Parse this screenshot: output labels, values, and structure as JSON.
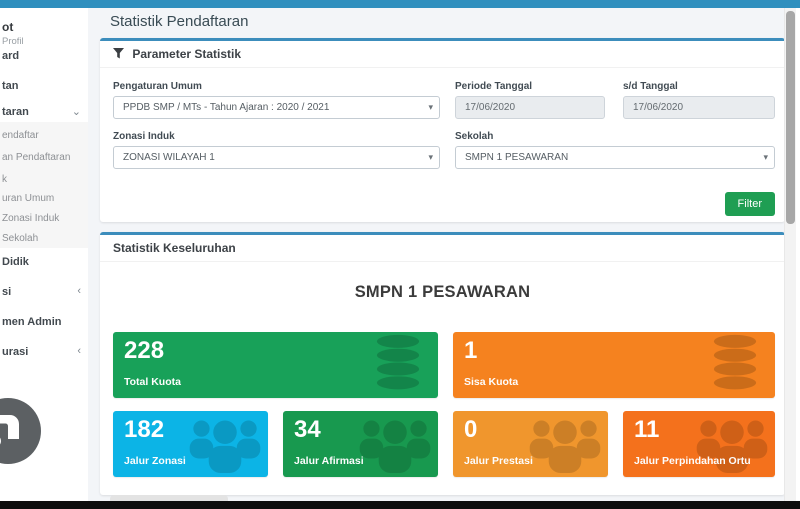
{
  "chrome": {
    "top_bar_color": "#2f8fbe",
    "bottom_bar_color": "#0d0d0d",
    "card_accent_color": "#3c8dbc"
  },
  "icons": {
    "chevron_down": "⌄",
    "chevron_left": "‹",
    "dropdown_caret": "▾"
  },
  "sidebar": {
    "user_name_fragment": "ot",
    "user_link_fragment": "Profil",
    "items": [
      {
        "label": "ard"
      },
      {
        "label": "tan"
      },
      {
        "label": "taran"
      },
      {
        "label": "endaftar"
      },
      {
        "label": "an Pendaftaran"
      },
      {
        "label": "k"
      },
      {
        "label": "uran Umum"
      },
      {
        "label": "Zonasi Induk"
      },
      {
        "label": "Sekolah"
      },
      {
        "label": "Didik"
      },
      {
        "label": "si"
      },
      {
        "label": "men Admin"
      },
      {
        "label": "urasi"
      }
    ]
  },
  "page_title": "Statistik Pendaftaran",
  "filter_card": {
    "header": "Parameter Statistik",
    "fields": {
      "pengaturan_umum": {
        "label": "Pengaturan Umum",
        "value": "PPDB SMP / MTs - Tahun Ajaran : 2020 / 2021"
      },
      "periode_tanggal": {
        "label": "Periode Tanggal",
        "value": "17/06/2020"
      },
      "sd_tanggal": {
        "label": "s/d Tanggal",
        "value": "17/06/2020"
      },
      "zonasi_induk": {
        "label": "Zonasi Induk",
        "value": "ZONASI WILAYAH 1"
      },
      "sekolah": {
        "label": "Sekolah",
        "value": "SMPN 1 PESAWARAN"
      }
    },
    "filter_button": "Filter",
    "filter_button_color": "#1f9e53"
  },
  "stats_card": {
    "header": "Statistik Keseluruhan",
    "school_title": "SMPN 1 PESAWARAN",
    "boxes": [
      {
        "value": "228",
        "label": "Total Kuota",
        "color": "#18a159",
        "icon": "database-icon"
      },
      {
        "value": "1",
        "label": "Sisa Kuota",
        "color": "#f5821f",
        "icon": "database-icon"
      },
      {
        "value": "182",
        "label": "Jalur Zonasi",
        "color": "#0cb4e6",
        "icon": "users-group-icon"
      },
      {
        "value": "34",
        "label": "Jalur Afirmasi",
        "color": "#18994f",
        "icon": "users-group-icon"
      },
      {
        "value": "0",
        "label": "Jalur Prestasi",
        "color": "#f0962d",
        "icon": "users-group-icon"
      },
      {
        "value": "11",
        "label": "Jalur Perpindahan Ortu",
        "color": "#f4711c",
        "icon": "users-group-icon"
      }
    ]
  }
}
